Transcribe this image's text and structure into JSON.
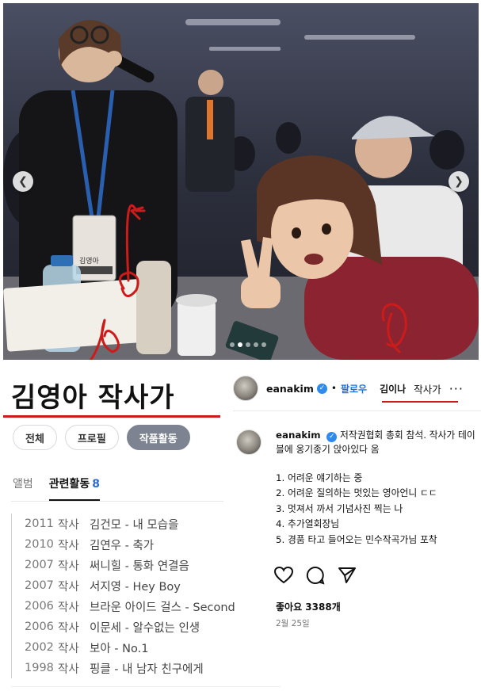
{
  "photo": {
    "nametag_text": "김영아",
    "slide_count": 5,
    "active_slide": 2
  },
  "left_panel": {
    "title": "김영아 작사가",
    "tabs": [
      {
        "label": "전체",
        "active": false
      },
      {
        "label": "프로필",
        "active": false
      },
      {
        "label": "작품활동",
        "active": true
      }
    ],
    "subtabs": {
      "album": "앨범",
      "activities": "관련활동",
      "activities_count": "8"
    },
    "works": [
      {
        "year": "2011",
        "role": "작사",
        "title": "김건모 - 내 모습을",
        "highlight": false
      },
      {
        "year": "2010",
        "role": "작사",
        "title": "김연우 - 축가",
        "highlight": false
      },
      {
        "year": "2007",
        "role": "작사",
        "title": "써니힐 - 통화 연결음",
        "highlight": false
      },
      {
        "year": "2007",
        "role": "작사",
        "title": "서지영 - Hey Boy",
        "highlight": false
      },
      {
        "year": "2006",
        "role": "작사",
        "title": "브라운 아이드 걸스 - Second",
        "highlight": false
      },
      {
        "year": "2006",
        "role": "작사",
        "title": "이문세 - 알수없는 인생",
        "highlight": true
      },
      {
        "year": "2002",
        "role": "작사",
        "title": "보아 - No.1",
        "highlight": false
      },
      {
        "year": "1998",
        "role": "작사",
        "title": "핑클 - 내 남자 친구에게",
        "highlight": false
      }
    ]
  },
  "right_panel": {
    "header": {
      "handle": "eanakim",
      "separator": "•",
      "follow_label": "팔로우",
      "name": "김이나",
      "subtitle": "작사가",
      "more": "···"
    },
    "post": {
      "handle": "eanakim",
      "caption": "저작권협회 총회 참석. 작사가 테이블에 옹기종기 앉아있다 옴",
      "list": [
        {
          "text": "1. 어려운 얘기하는 중",
          "highlight": false
        },
        {
          "text": "2. 어려운 질의하는 멋있는 영아언니 ㄷㄷ",
          "highlight": true
        },
        {
          "text": "3. 멋져서 까서 기념사진 찍는 나",
          "highlight": false
        },
        {
          "text": "4. 추가열회장님",
          "highlight": false
        },
        {
          "text": "5. 경품 타고 들어오는 민수작곡가님 포착",
          "highlight": false
        }
      ]
    },
    "likes": "좋아요 3388개",
    "date": "2월 25일"
  },
  "icons": {
    "prev": "chevron-left-icon",
    "next": "chevron-right-icon",
    "like": "heart-icon",
    "comment": "comment-icon",
    "share": "share-icon",
    "verified": "verified-badge-icon"
  },
  "colors": {
    "annotation_red": "#cc1b1b",
    "highlight_orange": "#ffb27a",
    "active_pill": "#7d8390",
    "follow_blue": "#1b74e4",
    "count_blue": "#2c6bd1"
  }
}
